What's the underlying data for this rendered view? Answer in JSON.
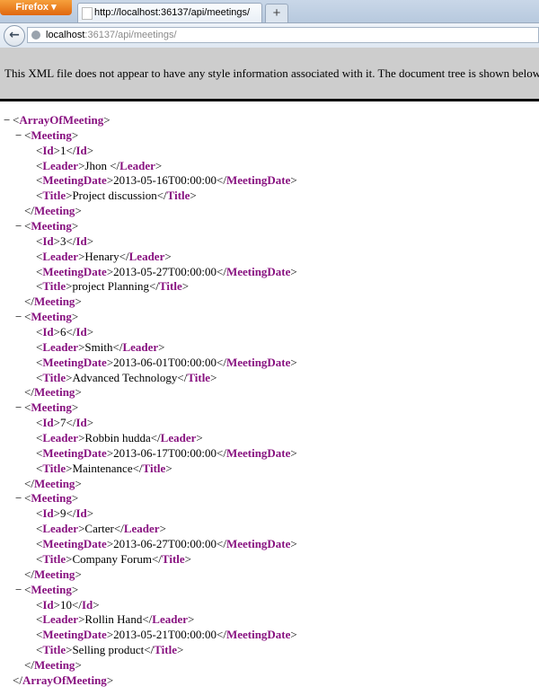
{
  "browser": {
    "menu_label": "Firefox ▾",
    "tab_title": "http://localhost:36137/api/meetings/",
    "new_tab": "+",
    "url_host": "localhost",
    "url_rest": ":36137/api/meetings/"
  },
  "banner": "This XML file does not appear to have any style information associated with it. The document tree is shown below.",
  "root": "ArrayOfMeeting",
  "meeting_tag": "Meeting",
  "fields": [
    "Id",
    "Leader",
    "MeetingDate",
    "Title"
  ],
  "meetings": [
    {
      "Id": "1",
      "Leader": "Jhon ",
      "MeetingDate": "2013-05-16T00:00:00",
      "Title": "Project discussion"
    },
    {
      "Id": "3",
      "Leader": "Henary",
      "MeetingDate": "2013-05-27T00:00:00",
      "Title": "project Planning"
    },
    {
      "Id": "6",
      "Leader": "Smith",
      "MeetingDate": "2013-06-01T00:00:00",
      "Title": "Advanced Technology"
    },
    {
      "Id": "7",
      "Leader": "Robbin hudda",
      "MeetingDate": "2013-06-17T00:00:00",
      "Title": "Maintenance"
    },
    {
      "Id": "9",
      "Leader": "Carter",
      "MeetingDate": "2013-06-27T00:00:00",
      "Title": "Company Forum"
    },
    {
      "Id": "10",
      "Leader": "Rollin Hand",
      "MeetingDate": "2013-05-21T00:00:00",
      "Title": "Selling product"
    }
  ]
}
